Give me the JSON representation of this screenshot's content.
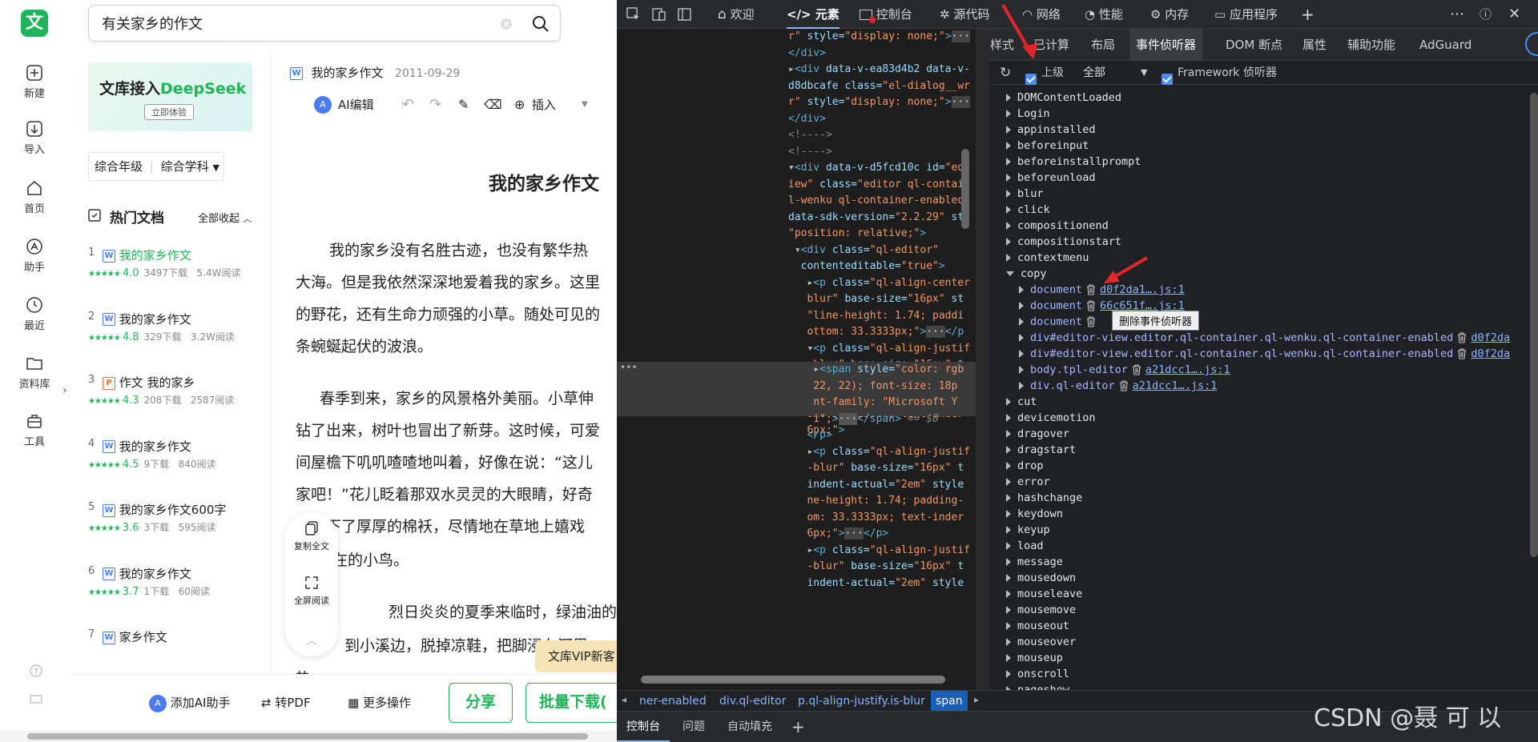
{
  "app": {
    "logo_char": "文",
    "rail": [
      {
        "label": "新建",
        "icon": "plus-icon"
      },
      {
        "label": "导入",
        "icon": "import-icon"
      },
      {
        "label": "首页",
        "icon": "home-icon"
      },
      {
        "label": "助手",
        "icon": "assistant-icon"
      },
      {
        "label": "最近",
        "icon": "clock-icon"
      },
      {
        "label": "资料库",
        "icon": "folder-icon"
      },
      {
        "label": "工具",
        "icon": "toolbox-icon"
      }
    ]
  },
  "search": {
    "value": "有关家乡的作文"
  },
  "promo": {
    "line1": "文库接入",
    "brand": "DeepSeek",
    "button": "立即体验"
  },
  "filters": {
    "grade": "综合年级",
    "subject": "综合学科"
  },
  "hot_docs": {
    "title": "热门文档",
    "collapse_label": "全部收起",
    "items": [
      {
        "num": "1",
        "type": "W",
        "title": "我的家乡作文",
        "score": "4.0",
        "downloads": "3497下载",
        "reads": "5.4W阅读"
      },
      {
        "num": "2",
        "type": "W",
        "title": "我的家乡作文",
        "score": "4.8",
        "downloads": "329下载",
        "reads": "3.2W阅读"
      },
      {
        "num": "3",
        "type": "P",
        "title": "作文 我的家乡",
        "score": "4.3",
        "downloads": "208下载",
        "reads": "2587阅读"
      },
      {
        "num": "4",
        "type": "W",
        "title": "我的家乡作文",
        "score": "4.5",
        "downloads": "9下载",
        "reads": "840阅读"
      },
      {
        "num": "5",
        "type": "W",
        "title": "我的家乡作文600字",
        "score": "3.6",
        "downloads": "3下载",
        "reads": "595阅读"
      },
      {
        "num": "6",
        "type": "W",
        "title": "我的家乡作文",
        "score": "3.7",
        "downloads": "1下载",
        "reads": "60阅读"
      },
      {
        "num": "7",
        "type": "W",
        "title": "家乡作文",
        "score": "",
        "downloads": "",
        "reads": ""
      }
    ]
  },
  "document": {
    "name": "我的家乡作文",
    "date": "2011-09-29",
    "ai_edit": "AI编辑",
    "insert": "插入",
    "heading": "我的家乡作文",
    "paragraphs": [
      "我的家乡没有名胜古迹，也没有繁华热",
      "大海。但是我依然深深地爱着我的家乡。这里",
      "的野花，还有生命力顽强的小草。随处可见的",
      "条蜿蜒起伏的波浪。",
      "春季到来，家乡的风景格外美丽。小草伸",
      "钻了出来，树叶也冒出了新芽。这时候，可爱",
      "间屋檐下叽叽喳喳地叫着，好像在说：“这儿",
      "家吧！”花儿眨着那双水灵灵的大眼睛，好奇",
      "子脱下了厚厚的棉袄，尽情地在草地上嬉戏",
      "在的小鸟。",
      "烈日炎炎的夏季来临时，绿油油的西瓜",
      "到小溪边，脱掉凉鞋，把脚浸在河里",
      "热。"
    ]
  },
  "float_tools": {
    "copy": "复制全文",
    "fullscreen": "全屏阅读"
  },
  "vip_banner": "文库VIP新客",
  "bottom_bar": {
    "ai": "添加AI助手",
    "pdf": "转PDF",
    "more": "更多操作",
    "share": "分享",
    "download": "批量下载("
  },
  "devtools": {
    "tabs": [
      "欢迎",
      "元素",
      "控制台",
      "源代码",
      "网络",
      "性能",
      "内存",
      "应用程序"
    ],
    "sidebar_tabs": [
      "样式",
      "已计算",
      "布局",
      "事件侦听器",
      "DOM 断点",
      "属性",
      "辅助功能",
      "AdGuard"
    ],
    "ancestors_label": "上级",
    "all_label": "全部",
    "framework_label": "Framework 侦听器",
    "tooltip": "删除事件侦听器",
    "events_before": [
      "DOMContentLoaded",
      "Login",
      "appinstalled",
      "beforeinput",
      "beforeinstallprompt",
      "beforeunload",
      "blur",
      "click",
      "compositionend",
      "compositionstart",
      "contextmenu",
      "copy"
    ],
    "copy_listeners": [
      {
        "node": "document",
        "source": "d0f2da1….js:1"
      },
      {
        "node": "document",
        "source": "66c651f….js:1"
      },
      {
        "node": "document",
        "source": ""
      },
      {
        "node": "div#editor-view.editor.ql-container.ql-wenku.ql-container-enabled",
        "source": "d0f2da"
      },
      {
        "node": "div#editor-view.editor.ql-container.ql-wenku.ql-container-enabled",
        "source": "d0f2da"
      },
      {
        "node": "body.tpl-editor",
        "source": "a21dcc1….js:1"
      },
      {
        "node": "div.ql-editor",
        "source": "a21dcc1….js:1"
      }
    ],
    "events_after": [
      "cut",
      "devicemotion",
      "dragover",
      "dragstart",
      "drop",
      "error",
      "hashchange",
      "keydown",
      "keyup",
      "load",
      "message",
      "mousedown",
      "mouseleave",
      "mousemove",
      "mouseout",
      "mouseover",
      "mouseup",
      "onscroll",
      "pageshow"
    ],
    "breadcrumbs": [
      "ner-enabled",
      "div.ql-editor",
      "p.ql-align-justify.is-blur",
      "span"
    ],
    "drawer_tabs": [
      "控制台",
      "问题",
      "自动填充"
    ],
    "watermark": "CSDN @聂 可 以"
  },
  "colors": {
    "accent_green": "#20b55a",
    "blue": "#4a7cf0",
    "devtools_bg": "#1f1f1f",
    "arrow_red": "#e0262d"
  }
}
